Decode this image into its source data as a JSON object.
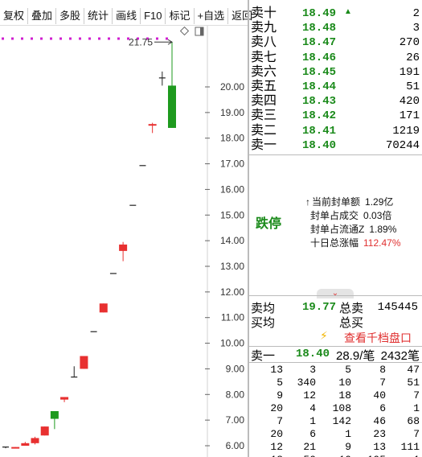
{
  "toolbar": {
    "buttons": [
      "复权",
      "叠加",
      "多股",
      "统计",
      "画线",
      "F10",
      "标记",
      "+自选",
      "返回"
    ]
  },
  "chart": {
    "y_ticks": [
      "20.00",
      "19.00",
      "18.00",
      "17.00",
      "16.00",
      "15.00",
      "14.00",
      "13.00",
      "12.00",
      "11.00",
      "10.00",
      "9.00",
      "8.00",
      "7.00",
      "6.00"
    ],
    "high_annotation": "21.75",
    "colors": {
      "up": "#e83030",
      "down": "#1e9a1e",
      "line": "#222222",
      "limit": "#d020d0"
    }
  },
  "chart_data": {
    "type": "candlestick",
    "ylim": [
      5.7,
      22.0
    ],
    "candles": [
      {
        "o": 5.95,
        "c": 5.95,
        "h": 5.95,
        "l": 5.9
      },
      {
        "o": 5.9,
        "c": 5.95,
        "h": 5.95,
        "l": 5.9
      },
      {
        "o": 6.0,
        "c": 6.1,
        "h": 6.15,
        "l": 6.0
      },
      {
        "o": 6.1,
        "c": 6.3,
        "h": 6.35,
        "l": 6.05
      },
      {
        "o": 6.4,
        "c": 6.75,
        "h": 6.75,
        "l": 6.4
      },
      {
        "o": 7.35,
        "c": 7.05,
        "h": 7.35,
        "l": 6.65
      },
      {
        "o": 7.8,
        "c": 7.9,
        "h": 7.9,
        "l": 7.7
      },
      {
        "o": 8.68,
        "c": 8.68,
        "h": 9.1,
        "l": 8.68
      },
      {
        "o": 9.0,
        "c": 9.5,
        "h": 9.5,
        "l": 9.0
      },
      {
        "o": 10.45,
        "c": 10.45,
        "h": 10.45,
        "l": 10.45
      },
      {
        "o": 11.2,
        "c": 11.55,
        "h": 11.55,
        "l": 11.2
      },
      {
        "o": 12.72,
        "c": 12.72,
        "h": 12.72,
        "l": 12.72
      },
      {
        "o": 13.6,
        "c": 13.85,
        "h": 13.95,
        "l": 13.2
      },
      {
        "o": 15.38,
        "c": 15.38,
        "h": 15.38,
        "l": 15.38
      },
      {
        "o": 16.93,
        "c": 16.93,
        "h": 16.93,
        "l": 16.93
      },
      {
        "o": 18.5,
        "c": 18.55,
        "h": 18.6,
        "l": 18.2
      },
      {
        "o": 20.35,
        "c": 20.35,
        "h": 20.6,
        "l": 20.05
      },
      {
        "o": 20.05,
        "c": 18.4,
        "h": 21.75,
        "l": 18.4
      }
    ]
  },
  "order_book": {
    "sell": [
      {
        "label": "卖十",
        "price": "18.49",
        "vol": "2",
        "arrow": true
      },
      {
        "label": "卖九",
        "price": "18.48",
        "vol": "3"
      },
      {
        "label": "卖八",
        "price": "18.47",
        "vol": "270"
      },
      {
        "label": "卖七",
        "price": "18.46",
        "vol": "26"
      },
      {
        "label": "卖六",
        "price": "18.45",
        "vol": "191"
      },
      {
        "label": "卖五",
        "price": "18.44",
        "vol": "51"
      },
      {
        "label": "卖四",
        "price": "18.43",
        "vol": "420"
      },
      {
        "label": "卖三",
        "price": "18.42",
        "vol": "171"
      },
      {
        "label": "卖二",
        "price": "18.41",
        "vol": "1219"
      },
      {
        "label": "卖一",
        "price": "18.40",
        "vol": "70244"
      }
    ]
  },
  "panel": {
    "status": "跌停",
    "stats": [
      {
        "label": "当前封单额",
        "value": "1.29亿",
        "red": false
      },
      {
        "label": "封单占成交",
        "value": "0.03倍",
        "red": false
      },
      {
        "label": "封单占流通Z",
        "value": "1.89%",
        "red": false
      },
      {
        "label": "十日总涨幅",
        "value": "112.47%",
        "red": true
      }
    ]
  },
  "summary": {
    "avg_sell_label": "卖均",
    "avg_buy_label": "买均",
    "avg_price": "19.77",
    "total_sell_label": "总卖",
    "total_buy_label": "总买",
    "total_sell": "145445"
  },
  "link": {
    "label": "查看千档盘口"
  },
  "trade": {
    "label": "卖一",
    "price": "18.40",
    "per_trade": "28.9/笔",
    "count": "2432笔"
  },
  "ticks": [
    [
      "13",
      "3",
      "5",
      "8",
      "47"
    ],
    [
      "5",
      "340",
      "10",
      "7",
      "51"
    ],
    [
      "9",
      "12",
      "18",
      "40",
      "7"
    ],
    [
      "20",
      "4",
      "108",
      "6",
      "1"
    ],
    [
      "7",
      "1",
      "142",
      "46",
      "68"
    ],
    [
      "20",
      "6",
      "1",
      "23",
      "7"
    ],
    [
      "12",
      "21",
      "9",
      "13",
      "111"
    ],
    [
      "18",
      "50",
      "10",
      "105",
      "1"
    ]
  ]
}
